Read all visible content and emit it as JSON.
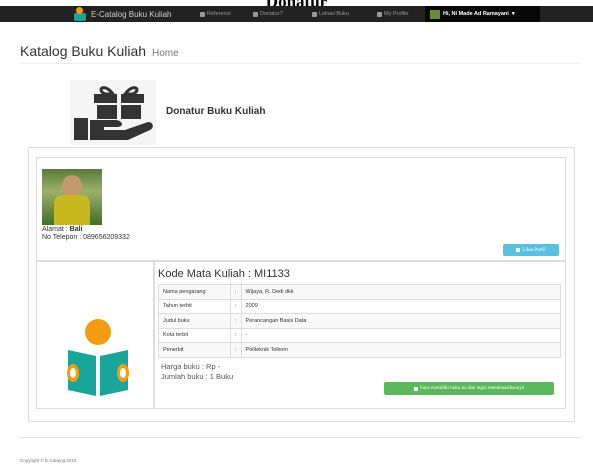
{
  "caption": "Donatur",
  "navbar": {
    "brand": "E-Catalog Buku Kuliah",
    "items": [
      {
        "label": "Referensi",
        "icon": "book-icon"
      },
      {
        "label": "Donatur?",
        "icon": "users-icon"
      },
      {
        "label": "Lokasi Buku",
        "icon": "map-marker-icon"
      },
      {
        "label": "My Profile",
        "icon": "user-icon"
      }
    ],
    "user": "Hi, Ni Made Ad Ramayani",
    "user_caret": "▾"
  },
  "header": {
    "title": "Katalog Buku Kuliah",
    "subtitle": "Home"
  },
  "donatur": {
    "title": "Donatur Buku Kuliah"
  },
  "profile": {
    "alamat_label": "Alamat :",
    "alamat_value": "Bali",
    "telepon": "No Telepon : 089656209332",
    "lihat_profil": "Lihat Profil"
  },
  "book": {
    "kode": "Kode Mata Kuliah : MI1133",
    "rows": [
      {
        "label": "Nama pengarang",
        "sep": ":",
        "value": "Wijaya, R. Dedi dkk"
      },
      {
        "label": "Tahun terbit",
        "sep": ":",
        "value": "2009"
      },
      {
        "label": "Judul buku",
        "sep": ":",
        "value": "Perancangan Basis Data"
      },
      {
        "label": "Kota terbit",
        "sep": ":",
        "value": "-"
      },
      {
        "label": "Penerbit",
        "sep": ":",
        "value": "Politeknik Telkom"
      }
    ],
    "harga": "Harga buku : Rp -",
    "jumlah": "Jumlah buku : 1 Buku",
    "action": "Saya memiliki buku ini dan ingin mendonasikannya"
  },
  "footer": "Copyright © E-Catalog 2015",
  "colors": {
    "navbar": "#222222",
    "info": "#5bc0de",
    "success": "#5cb85c",
    "teal": "#1aa59a",
    "orange": "#f39c12"
  }
}
